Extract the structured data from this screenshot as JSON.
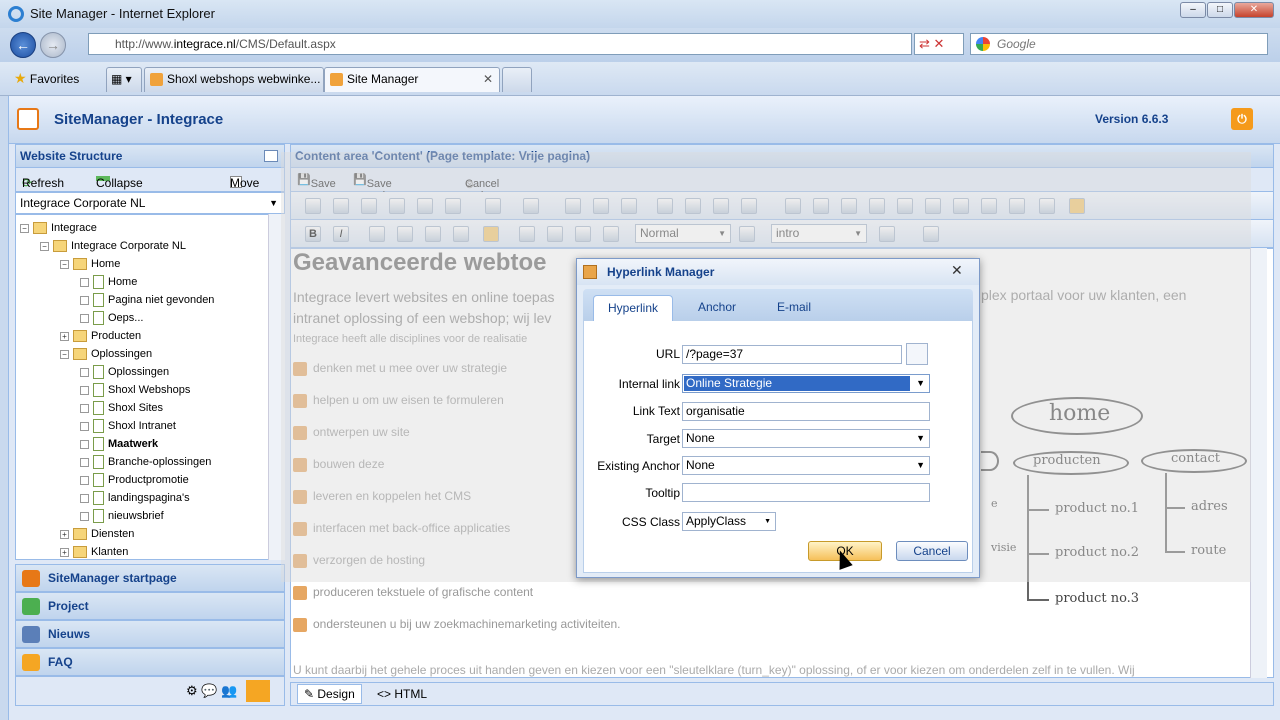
{
  "browser": {
    "title": "Site Manager - Internet Explorer",
    "url_prefix": "http://www.",
    "url_domain": "integrace.nl",
    "url_path": "/CMS/Default.aspx",
    "search_placeholder": "Google",
    "favorites_label": "Favorites",
    "tabs": [
      {
        "label": "Shoxl webshops webwinke..."
      },
      {
        "label": "Site Manager"
      }
    ]
  },
  "app": {
    "title": "SiteManager - Integrace",
    "version": "Version 6.6.3"
  },
  "left": {
    "panel_title": "Website Structure",
    "refresh_label": "Refresh",
    "collapse_label": "Collapse all",
    "move_label": "Move",
    "site_select": "Integrace Corporate NL",
    "tree": [
      {
        "label": "Integrace",
        "type": "root"
      },
      {
        "label": "Integrace Corporate NL",
        "type": "site"
      },
      {
        "label": "Home",
        "type": "folder"
      },
      {
        "label": "Home",
        "type": "page"
      },
      {
        "label": "Pagina niet gevonden",
        "type": "page"
      },
      {
        "label": "Oeps...",
        "type": "page"
      },
      {
        "label": "Producten",
        "type": "folder"
      },
      {
        "label": "Oplossingen",
        "type": "folder"
      },
      {
        "label": "Oplossingen",
        "type": "page"
      },
      {
        "label": "Shoxl Webshops",
        "type": "page"
      },
      {
        "label": "Shoxl Sites",
        "type": "page"
      },
      {
        "label": "Shoxl Intranet",
        "type": "page"
      },
      {
        "label": "Maatwerk",
        "type": "page"
      },
      {
        "label": "Branche-oplossingen",
        "type": "page"
      },
      {
        "label": "Productpromotie",
        "type": "page"
      },
      {
        "label": "landingspagina's",
        "type": "page"
      },
      {
        "label": "nieuwsbrief",
        "type": "page"
      },
      {
        "label": "Diensten",
        "type": "folder"
      },
      {
        "label": "Klanten",
        "type": "folder"
      }
    ],
    "accordion": [
      {
        "label": "SiteManager startpage",
        "color": "#e77817"
      },
      {
        "label": "Project",
        "color": "#4caf50"
      },
      {
        "label": "Nieuws",
        "color": "#5b7fb8"
      },
      {
        "label": "FAQ",
        "color": "#f5a623"
      }
    ]
  },
  "content": {
    "area_title": "Content area 'Content' (Page template: Vrije pagina)",
    "save_label": "Save",
    "save_close_label": "Save and Close",
    "cancel_close_label": "Cancel and Close",
    "format_select": "Normal",
    "style_select": "intro",
    "heading": "Geavanceerde webtoe",
    "intro_left": "Integrace levert websites en online toepas intranet oplossing of een webshop; wij lev",
    "intro_right": "plex portaal voor uw klanten, een",
    "small_text": "Integrace heeft alle disciplines voor de realisatie",
    "bullets": [
      "denken met u mee over uw strategie",
      "helpen u om uw eisen te formuleren",
      "ontwerpen uw site",
      "bouwen deze",
      "leveren en koppelen het CMS",
      "interfacen met back-office applicaties",
      "verzorgen de hosting",
      "produceren tekstuele of grafische content",
      "ondersteunen u bij uw zoekmachinemarketing activiteiten."
    ],
    "footer_line": "U kunt daarbij het gehele proces uit handen geven en kiezen voor een \"sleutelklare (turn_key)\" oplossing, of er voor kiezen om onderdelen zelf in te vullen. Wij",
    "sketch": {
      "home": "home",
      "producten": "producten",
      "contact": "contact",
      "p1": "product no.1",
      "p2": "product no.2",
      "p3": "product no.3",
      "adres": "adres",
      "route": "route",
      "visie": "visie",
      "e": "e"
    },
    "mode_design": "Design",
    "mode_html": "HTML"
  },
  "dialog": {
    "title": "Hyperlink Manager",
    "tabs": [
      "Hyperlink",
      "Anchor",
      "E-mail"
    ],
    "url_label": "URL",
    "url_value": "/?page=37",
    "internal_label": "Internal link",
    "internal_value": "Online Strategie",
    "linktext_label": "Link Text",
    "linktext_value": "organisatie",
    "target_label": "Target",
    "target_value": "None",
    "anchor_label": "Existing Anchor",
    "anchor_value": "None",
    "tooltip_label": "Tooltip",
    "tooltip_value": "",
    "css_label": "CSS Class",
    "css_value": "ApplyClass",
    "ok_label": "OK",
    "cancel_label": "Cancel"
  }
}
